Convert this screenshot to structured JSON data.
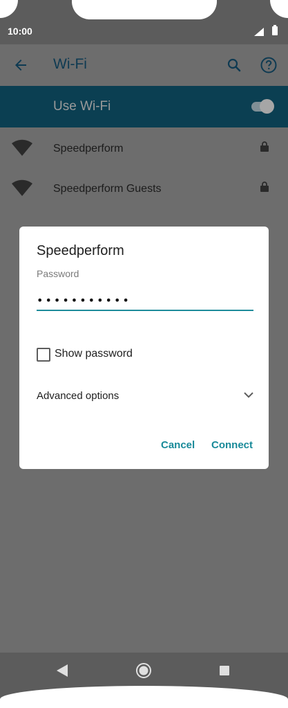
{
  "status_bar": {
    "time": "10:00"
  },
  "toolbar": {
    "title": "Wi-Fi"
  },
  "use_wifi": {
    "label": "Use Wi-Fi",
    "enabled": true
  },
  "networks": [
    {
      "name": "Speedperform",
      "secured": true
    },
    {
      "name": "Speedperform Guests",
      "secured": true
    }
  ],
  "dialog": {
    "title": "Speedperform",
    "password_label": "Password",
    "password_value": "•••••••••••",
    "show_password_label": "Show password",
    "advanced_options_label": "Advanced options",
    "cancel_label": "Cancel",
    "connect_label": "Connect"
  },
  "colors": {
    "accent": "#188a99",
    "toolbar_title": "#0e3a52",
    "banner": "#0b3f52",
    "scrim": "#6d6d6d"
  }
}
